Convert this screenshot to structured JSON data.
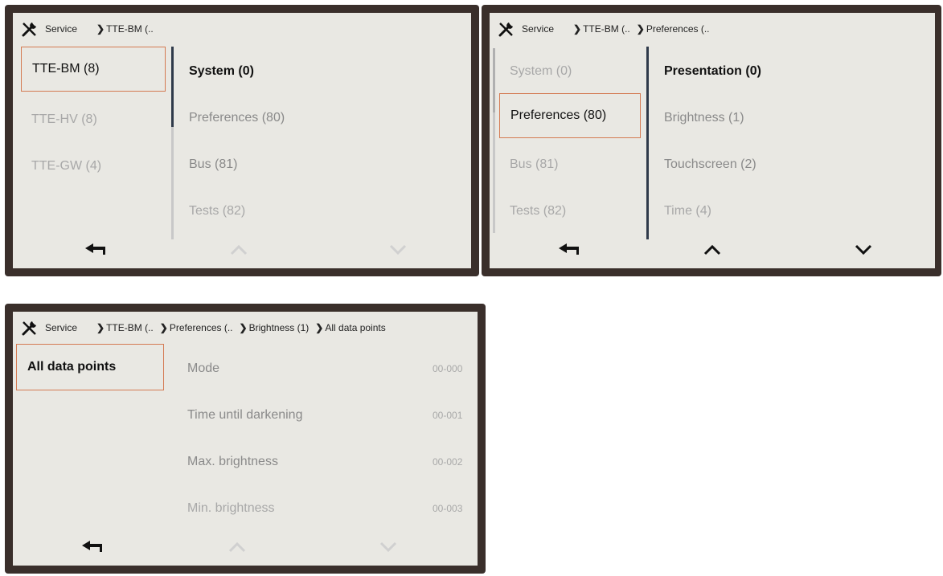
{
  "screen1": {
    "breadcrumb": [
      "Service",
      "TTE-BM (.."
    ],
    "left_items": [
      "TTE-BM (8)",
      "TTE-HV (8)",
      "TTE-GW (4)"
    ],
    "right_items": [
      "System (0)",
      "Preferences (80)",
      "Bus (81)",
      "Tests (82)"
    ],
    "nav": {
      "back": "back-arrow",
      "up_enabled": false,
      "down_enabled": false
    }
  },
  "screen2": {
    "breadcrumb": [
      "Service",
      "TTE-BM (..",
      "Preferences (.."
    ],
    "left_items": [
      "System (0)",
      "Preferences (80)",
      "Bus (81)",
      "Tests (82)"
    ],
    "right_items": [
      "Presentation (0)",
      "Brightness (1)",
      "Touchscreen (2)",
      "Time (4)"
    ],
    "nav": {
      "back": "back-arrow",
      "up_enabled": true,
      "down_enabled": true
    }
  },
  "screen3": {
    "breadcrumb": [
      "Service",
      "TTE-BM (..",
      "Preferences (..",
      "Brightness (1)",
      "All data points"
    ],
    "left_items": [
      "All data points"
    ],
    "rows": [
      {
        "label": "Mode",
        "code": "00-000"
      },
      {
        "label": "Time until darkening",
        "code": "00-001"
      },
      {
        "label": "Max. brightness",
        "code": "00-002"
      },
      {
        "label": "Min. brightness",
        "code": "00-003"
      }
    ],
    "nav": {
      "back": "back-arrow",
      "up_enabled": false,
      "down_enabled": false
    }
  },
  "colors": {
    "bezel": "#3a2f2b",
    "screen": "#e9e8e3",
    "selection_border": "#d47a52",
    "divider": "#2f3a4a",
    "dim_text": "#a8a8a8"
  }
}
